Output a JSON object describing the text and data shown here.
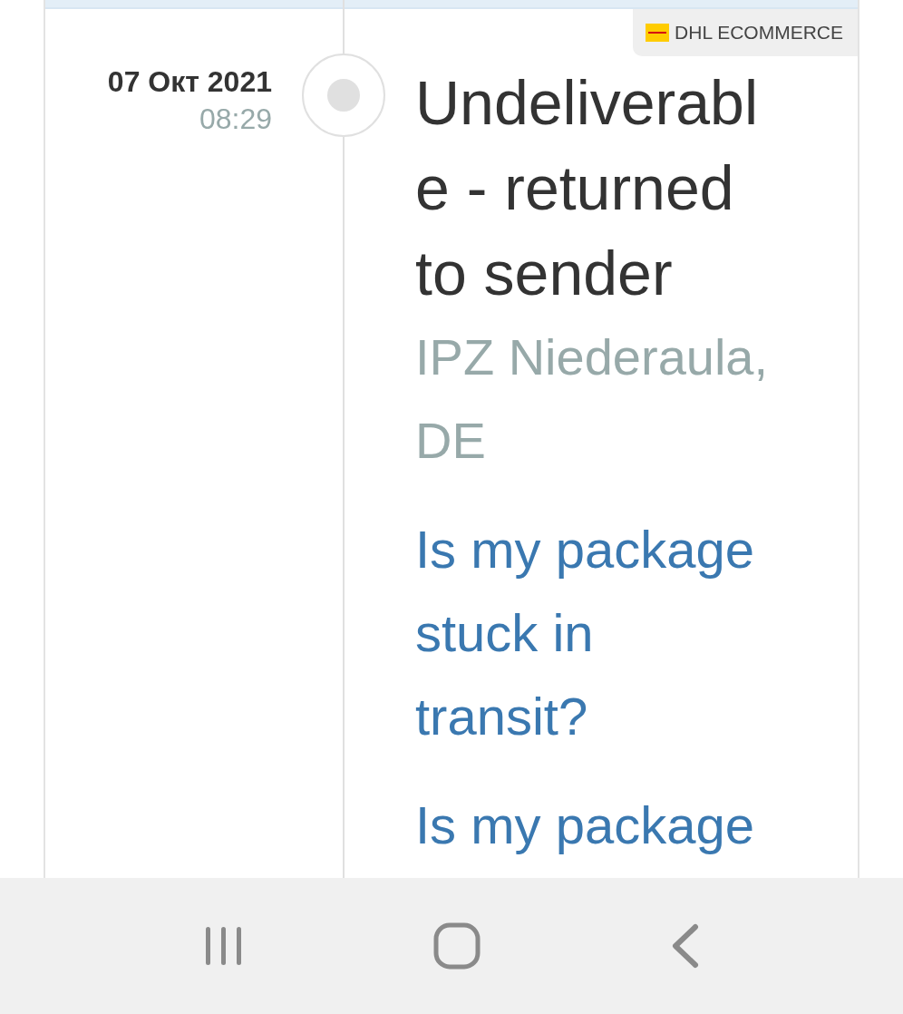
{
  "carrier": {
    "name": "DHL ECOMMERCE"
  },
  "events": [
    {
      "date": "07 Окт 2021",
      "time": "08:29",
      "status": "Undeliverable - returned to sender",
      "location": "IPZ Niederaula, DE"
    }
  ],
  "links": [
    "Is my package stuck in transit?",
    "Is my package"
  ],
  "nav_bar": {
    "buttons": [
      {
        "kind": "recent"
      },
      {
        "kind": "home"
      },
      {
        "kind": "back"
      }
    ]
  }
}
